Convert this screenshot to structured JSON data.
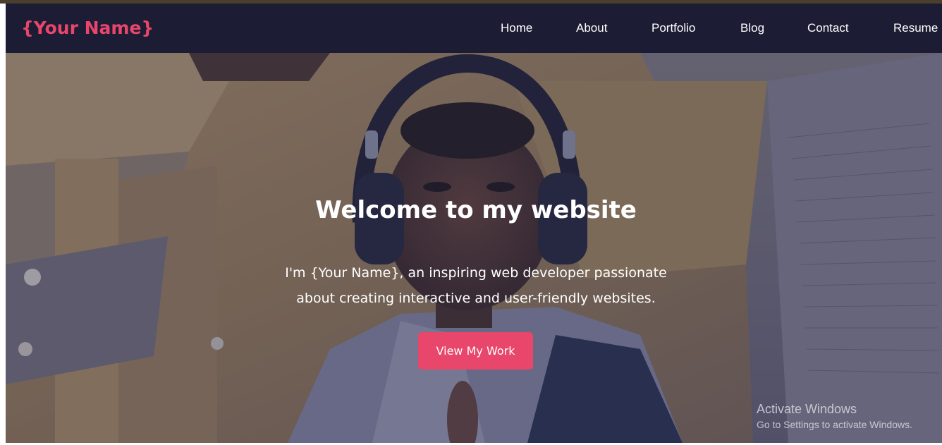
{
  "brand": {
    "logo_text": "{Your Name}"
  },
  "nav": {
    "items": [
      {
        "label": "Home"
      },
      {
        "label": "About"
      },
      {
        "label": "Portfolio"
      },
      {
        "label": "Blog"
      },
      {
        "label": "Contact"
      },
      {
        "label": "Resume"
      }
    ]
  },
  "hero": {
    "title": "Welcome to my website",
    "subtitle_line1": "I'm {Your Name}, an inspiring web developer passionate",
    "subtitle_line2": "about creating interactive and user-friendly websites.",
    "cta_label": "View My Work",
    "background_image": "portrait-photo-headphones"
  },
  "watermark": {
    "title": "Activate Windows",
    "subtitle": "Go to Settings to activate Windows."
  },
  "colors": {
    "accent": "#e8466a",
    "navbar": "#1c1c35",
    "text": "#ffffff"
  }
}
